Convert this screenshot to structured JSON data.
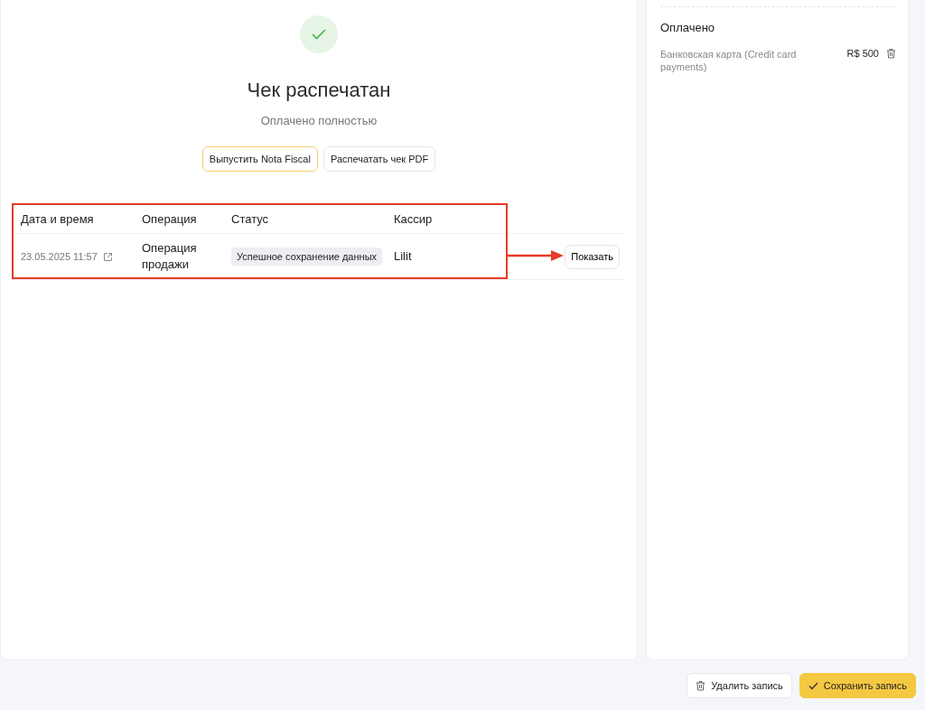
{
  "receipt": {
    "title": "Чек распечатан",
    "subtitle": "Оплачено полностью",
    "actions": [
      {
        "label": "Выпустить Nota Fiscal",
        "kind": "primary"
      },
      {
        "label": "Распечатать чек PDF",
        "kind": "secondary"
      }
    ]
  },
  "table": {
    "columns": [
      "Дата и время",
      "Операция",
      "Статус",
      "Кассир"
    ],
    "rows": [
      {
        "date": "23.05.2025 11:57",
        "operation": "Операция продажи",
        "status": "Успешное сохранение данных",
        "cashier": "Lilit",
        "action": "Показать"
      }
    ]
  },
  "payments": {
    "title": "Оплачено",
    "items": [
      {
        "method": "Банковская карта (Credit card payments)",
        "amount": "R$ 500"
      }
    ]
  },
  "footer": {
    "buttons": [
      {
        "label": "Удалить запись",
        "kind": "delete"
      },
      {
        "label": "Сохранить запись",
        "kind": "save"
      }
    ]
  }
}
